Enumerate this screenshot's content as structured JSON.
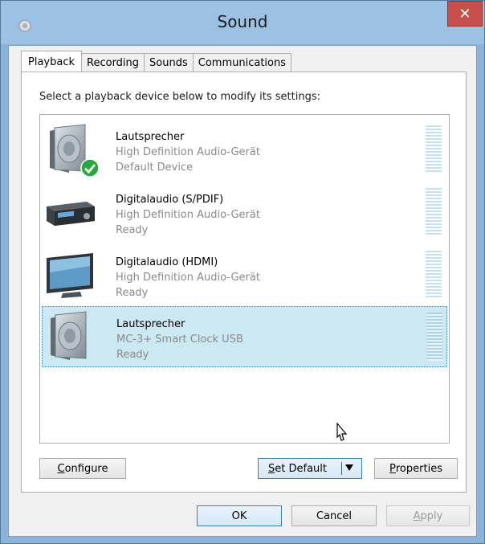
{
  "window": {
    "title": "Sound",
    "close_glyph": "✕"
  },
  "tabs": [
    {
      "label": "Playback",
      "active": true
    },
    {
      "label": "Recording",
      "active": false
    },
    {
      "label": "Sounds",
      "active": false
    },
    {
      "label": "Communications",
      "active": false
    }
  ],
  "instruction": "Select a playback device below to modify its settings:",
  "devices": [
    {
      "name": "Lautsprecher",
      "driver": "High Definition Audio-Gerät",
      "status": "Default Device",
      "icon": "speaker-icon",
      "is_default": true,
      "selected": false
    },
    {
      "name": "Digitalaudio (S/PDIF)",
      "driver": "High Definition Audio-Gerät",
      "status": "Ready",
      "icon": "audio-receiver-icon",
      "is_default": false,
      "selected": false
    },
    {
      "name": "Digitalaudio (HDMI)",
      "driver": "High Definition Audio-Gerät",
      "status": "Ready",
      "icon": "monitor-icon",
      "is_default": false,
      "selected": false
    },
    {
      "name": "Lautsprecher",
      "driver": "MC-3+ Smart Clock USB",
      "status": "Ready",
      "icon": "speaker-icon",
      "is_default": false,
      "selected": true
    }
  ],
  "buttons": {
    "configure": {
      "label": "Configure",
      "mnemonic": "C",
      "rest": "onfigure"
    },
    "set_default": {
      "label": "Set Default",
      "mnemonic": "S",
      "rest": "et Default"
    },
    "properties": {
      "label": "Properties",
      "mnemonic": "P",
      "rest": "roperties"
    },
    "ok": {
      "label": "OK"
    },
    "cancel": {
      "label": "Cancel"
    },
    "apply": {
      "label": "Apply",
      "mnemonic": "A",
      "rest": "pply",
      "disabled": true
    }
  },
  "colors": {
    "title_bar": "#9cc1e2",
    "close_button": "#c7504c",
    "selection": "#cce8f3",
    "default_check": "#2aa83f"
  }
}
